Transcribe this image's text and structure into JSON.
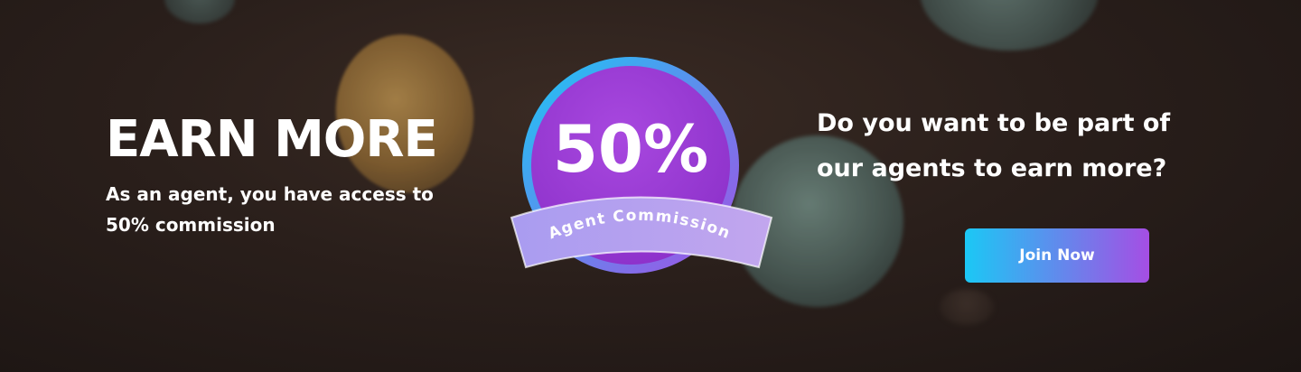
{
  "banner": {
    "headline": "EARN MORE",
    "subtext_line1": "As an agent, you have access to",
    "subtext_line2": "50% commission",
    "question_line1": "Do you want to be part of",
    "question_line2": "our agents to earn more?",
    "cta_label": "Join Now"
  },
  "badge": {
    "percent": "50%",
    "ribbon_text": "Agent  Commission"
  },
  "colors": {
    "background": "#2a1f1b",
    "text": "#ffffff",
    "ring_start": "#1bc8f5",
    "ring_end": "#a54ee4",
    "badge_fill": "#9d3fd8",
    "ribbon_fill": "#bca8ef"
  }
}
